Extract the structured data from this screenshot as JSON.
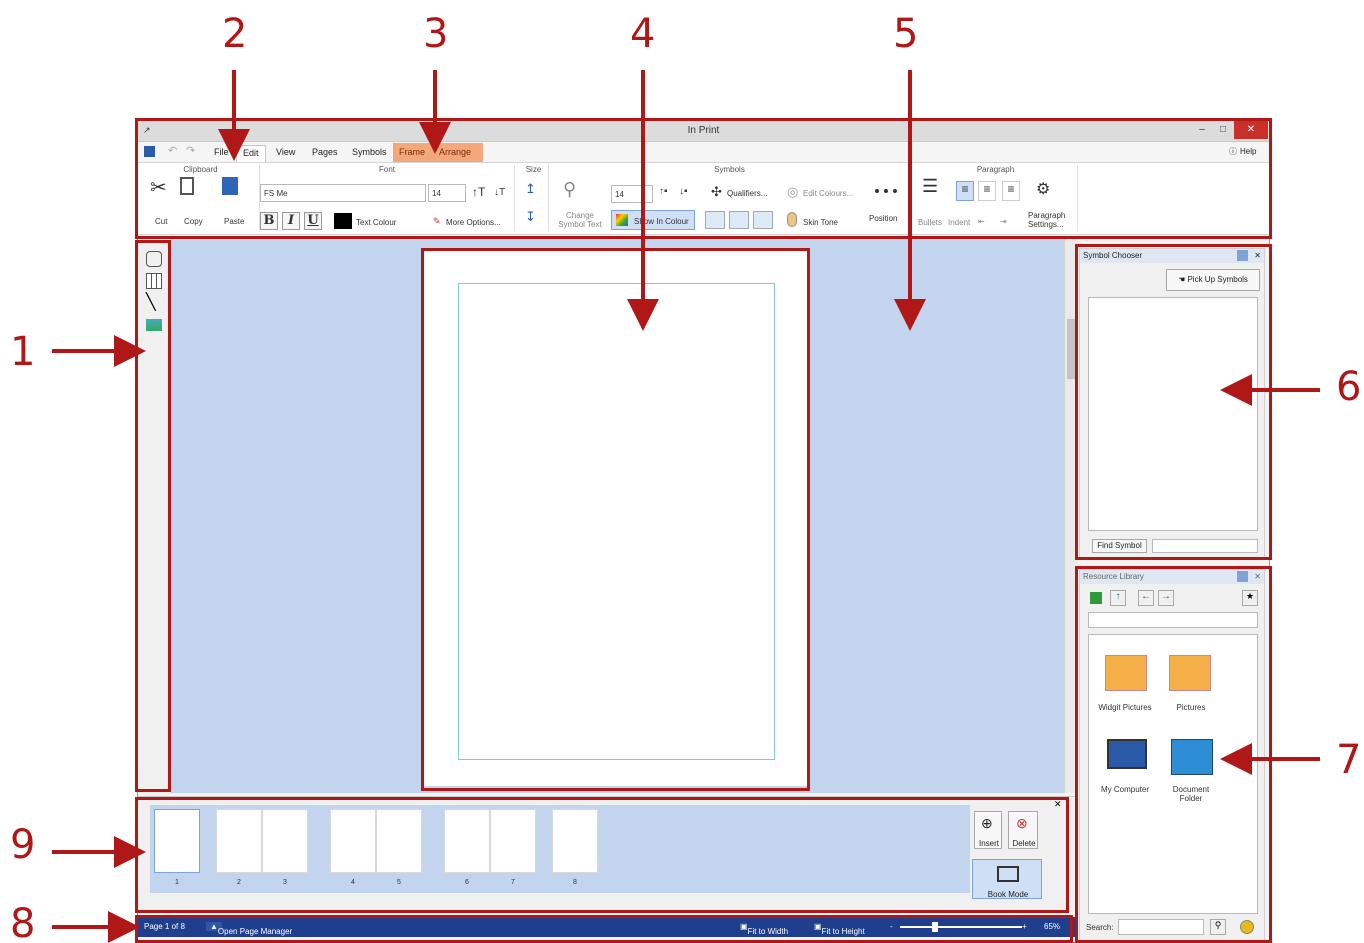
{
  "callouts": [
    "1",
    "2",
    "3",
    "4",
    "5",
    "6",
    "7",
    "8",
    "9"
  ],
  "window": {
    "title": "In Print",
    "help": "Help"
  },
  "tabs": [
    "File",
    "Edit",
    "View",
    "Pages",
    "Symbols",
    "Frame",
    "Arrange"
  ],
  "ribbon": {
    "clipboard": {
      "title": "Clipboard",
      "cut": "Cut",
      "copy": "Copy",
      "paste": "Paste"
    },
    "font": {
      "title": "Font",
      "family": "FS Me",
      "size": "14",
      "bold": "B",
      "italic": "I",
      "underline": "U",
      "text_colour": "Text Colour",
      "more": "More Options..."
    },
    "size": {
      "title": "Size"
    },
    "symbols": {
      "title": "Symbols",
      "size": "14",
      "change": "Change Symbol Text",
      "show_colour": "Show In Colour",
      "qualifiers": "Qualifiers...",
      "edit_colours": "Edit Colours...",
      "skin_tone": "Skin Tone",
      "position": "Position"
    },
    "paragraph": {
      "title": "Paragraph",
      "bullets": "Bullets",
      "indent": "Indent",
      "settings": "Paragraph Settings..."
    }
  },
  "symbol_chooser": {
    "title": "Symbol Chooser",
    "pickup": "Pick Up Symbols",
    "find": "Find Symbol"
  },
  "resource_library": {
    "title": "Resource Library",
    "items": [
      "Widgit Pictures",
      "Pictures",
      "My Computer",
      "Document Folder"
    ],
    "search_label": "Search:"
  },
  "pages": {
    "numbers": [
      "1",
      "2",
      "3",
      "4",
      "5",
      "6",
      "7",
      "8"
    ],
    "insert": "Insert",
    "delete": "Delete",
    "book_mode": "Book Mode"
  },
  "status": {
    "page": "Page 1 of 8",
    "manager": "Open Page Manager",
    "fit_width": "Fit to Width",
    "fit_height": "Fit to Height",
    "zoom": "65%"
  },
  "colors": {
    "accent": "#b01818",
    "canvas": "#c3d5ee",
    "status": "#1f3f8c",
    "context_tab": "#f2a87a"
  }
}
